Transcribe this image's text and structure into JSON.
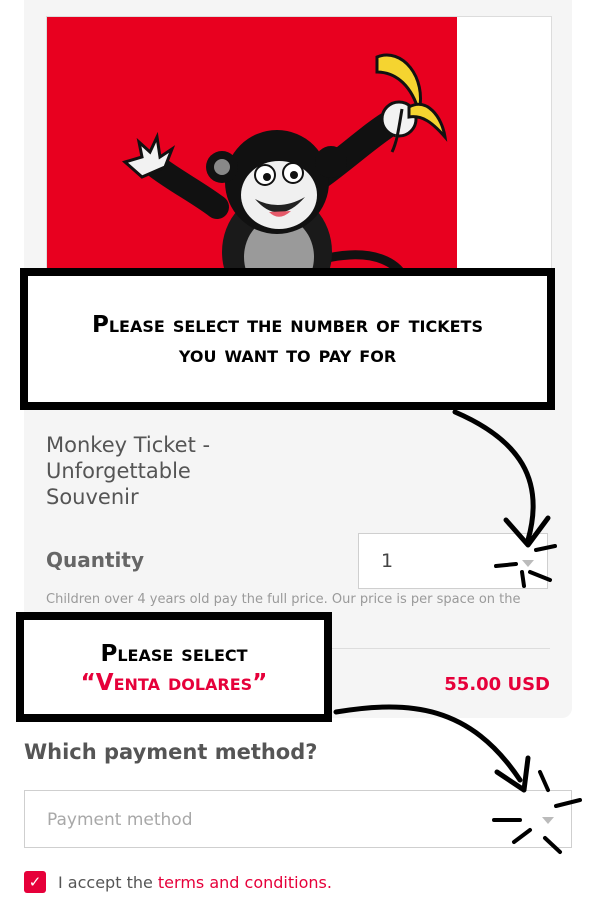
{
  "product": {
    "name": "Monkey Ticket -\nUnforgettable\nSouvenir",
    "image_icon": "monkey-with-banana-illustration"
  },
  "quantity": {
    "label": "Quantity",
    "value": "1"
  },
  "note": "Children over 4 years old pay the full price. Our price is per space on the",
  "price": "55.00 USD",
  "payment": {
    "heading": "Which payment method?",
    "placeholder": "Payment method"
  },
  "accept": {
    "prefix": "I accept the ",
    "link": "terms and conditions."
  },
  "callouts": {
    "tickets": {
      "line1": "Please select the number of tickets",
      "line2": "you want to pay for"
    },
    "payment": {
      "line1": "Please select",
      "line2": "“Venta dolares”"
    }
  },
  "colors": {
    "accent": "#e6003a",
    "image_background": "#e8001f",
    "card_background": "#f5f5f5"
  }
}
